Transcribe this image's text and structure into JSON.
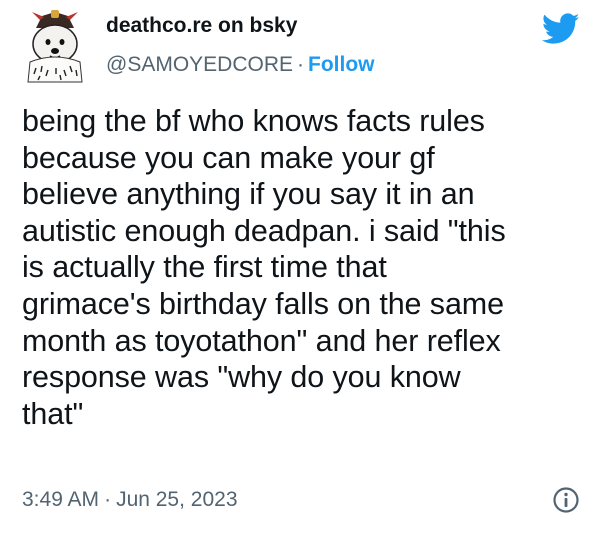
{
  "author": {
    "display_name": "deathco.re on bsky",
    "handle": "@SAMOYEDCORE",
    "separator": "·",
    "follow_label": "Follow",
    "avatar_icon": "samoyed-dog-avatar-icon"
  },
  "brand_icon": "twitter-bird-icon",
  "tweet": {
    "text": "being the bf who knows facts rules\nbecause you can make your gf\nbelieve anything if you say it in an\nautistic enough deadpan. i said \"this\nis actually the first time that\ngrimace's birthday falls on the same\nmonth as toyotathon\" and her reflex\nresponse was \"why do you know\nthat\""
  },
  "footer": {
    "time": "3:49 AM",
    "separator": "·",
    "date": "Jun 25, 2023",
    "info_icon": "info-icon"
  },
  "colors": {
    "accent": "#1d9bf0",
    "text": "#0f1419",
    "secondary": "#536471"
  }
}
